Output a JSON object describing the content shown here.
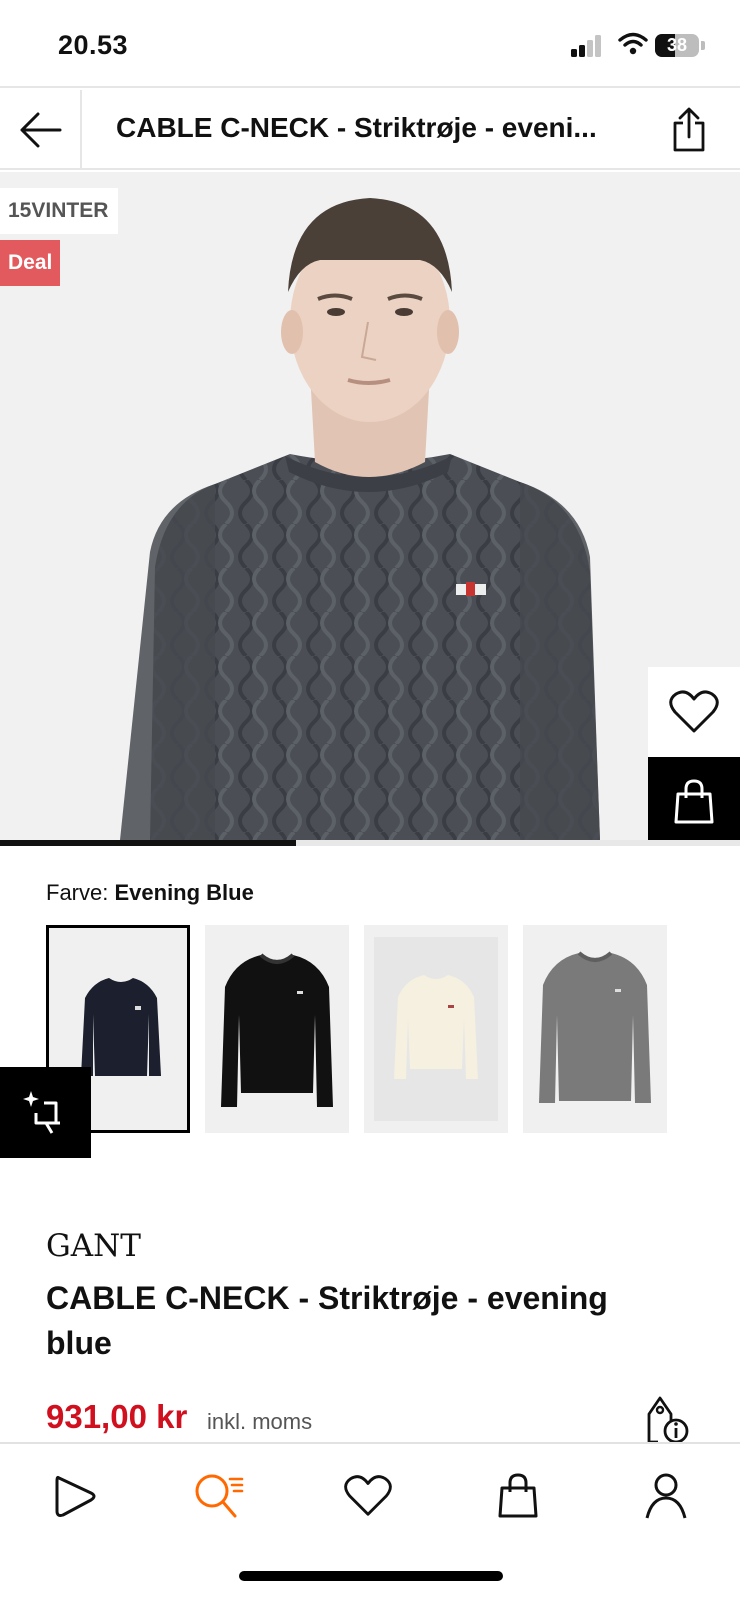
{
  "status_bar": {
    "time": "20.53",
    "battery": "38"
  },
  "header": {
    "title": "CABLE C-NECK - Striktrøje - eveni..."
  },
  "gallery": {
    "badges": [
      "15VINTER",
      "Deal"
    ],
    "progress": 0.4,
    "colors": {
      "deal_badge": "#e35a5e",
      "sweater": "#4b4f55"
    }
  },
  "color_selector": {
    "label": "Farve:",
    "selected": "Evening Blue",
    "swatches": [
      {
        "icon": "sweater-navy-thumbnail",
        "selected": true
      },
      {
        "icon": "sweater-black-thumbnail",
        "selected": false
      },
      {
        "icon": "sweater-cream-thumbnail",
        "selected": false
      },
      {
        "icon": "sweater-grey-thumbnail",
        "selected": false
      }
    ]
  },
  "product": {
    "brand": "GANT",
    "name": "CABLE C-NECK - Striktrøje - evening blue",
    "price": "931,00 kr",
    "price_note": "inkl. moms",
    "price_color": "#d0101f"
  },
  "bottom_nav": {
    "items": [
      "home-icon",
      "search-icon",
      "heart-icon",
      "bag-icon",
      "account-icon"
    ],
    "active": "search-icon",
    "active_color": "#ff6900"
  }
}
